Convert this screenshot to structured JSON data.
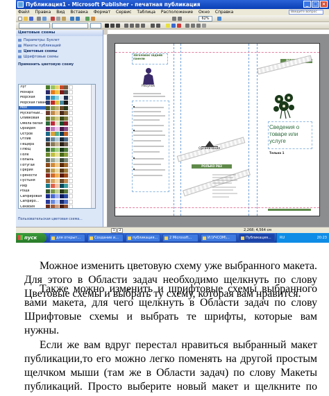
{
  "window": {
    "title": "Публикация1 - Microsoft Publisher - печатная публикация",
    "controls": [
      "_",
      "□",
      "×"
    ]
  },
  "menu": {
    "items": [
      "Файл",
      "Правка",
      "Вид",
      "Вставка",
      "Формат",
      "Сервис",
      "Таблица",
      "Расположение",
      "Окно",
      "Справка"
    ],
    "help_placeholder": "Введите вопрос"
  },
  "toolbar": {
    "zoom": "62%"
  },
  "task_pane": {
    "title": "Цветовые схемы",
    "nav_links": [
      "Параметры: Буклет",
      "Макеты публикаций",
      "Цветовые схемы",
      "Шрифтовые схемы"
    ],
    "active_link_index": 2,
    "apply_label": "Применить цветовую схему",
    "schemes": [
      {
        "name": "Луг",
        "colors": [
          "#4a7a2a",
          "#9cc45a",
          "#e8d46a",
          "#c84a2a",
          "#7a5a3a",
          "#ffffff"
        ]
      },
      {
        "name": "Монарх",
        "colors": [
          "#2a2a6a",
          "#e87a1a",
          "#f0c040",
          "#7a1a1a",
          "#4a4a4a",
          "#ffffff"
        ]
      },
      {
        "name": "Морская",
        "colors": [
          "#1a4a8a",
          "#3aa0c0",
          "#8ad0e0",
          "#e0e8f0",
          "#1a2a4a",
          "#ffffff"
        ]
      },
      {
        "name": "Морская гавань",
        "colors": [
          "#2a3a6a",
          "#c02a2a",
          "#e0c040",
          "#4a8aa0",
          "#1a1a1a",
          "#ffffff"
        ]
      },
      {
        "name": "Мох",
        "colors": [
          "#4a5a2a",
          "#8a9a4a",
          "#c0b070",
          "#6a4a2a",
          "#2a3a1a",
          "#ffffff"
        ]
      },
      {
        "name": "Мускатный...",
        "colors": [
          "#6a3a2a",
          "#c08a4a",
          "#e8c890",
          "#4a2a1a",
          "#8a6a3a",
          "#ffffff"
        ]
      },
      {
        "name": "Оливковая",
        "colors": [
          "#5a6a2a",
          "#9aa04a",
          "#d0c880",
          "#3a4a1a",
          "#7a7a3a",
          "#ffffff"
        ]
      },
      {
        "name": "Омела белая",
        "colors": [
          "#2a6a3a",
          "#c02a3a",
          "#e0e0c0",
          "#1a4a2a",
          "#8a1a2a",
          "#ffffff"
        ]
      },
      {
        "name": "Орхидея",
        "colors": [
          "#6a2a6a",
          "#c07ac0",
          "#e8c0e8",
          "#4a1a4a",
          "#8a4a8a",
          "#ffffff"
        ]
      },
      {
        "name": "Остров",
        "colors": [
          "#1a6a8a",
          "#e0a030",
          "#50b090",
          "#0a3a5a",
          "#c06020",
          "#ffffff"
        ]
      },
      {
        "name": "Отлив",
        "colors": [
          "#2a4a6a",
          "#6a8aa0",
          "#b0c8d8",
          "#1a2a3a",
          "#4a6a8a",
          "#ffffff"
        ]
      },
      {
        "name": "Пещера",
        "colors": [
          "#4a3a2a",
          "#8a7a5a",
          "#c0b090",
          "#2a2018",
          "#6a5a4a",
          "#ffffff"
        ]
      },
      {
        "name": "Плющ",
        "colors": [
          "#2a5a2a",
          "#5a9a4a",
          "#a0d080",
          "#1a3a1a",
          "#4a7a3a",
          "#ffffff"
        ]
      },
      {
        "name": "Поле",
        "colors": [
          "#6a8a2a",
          "#c0c040",
          "#e8e090",
          "#4a6a1a",
          "#8aa03a",
          "#ffffff"
        ]
      },
      {
        "name": "Полынь",
        "colors": [
          "#5a6a5a",
          "#9aa89a",
          "#d0d8c8",
          "#3a4a3a",
          "#7a8a7a",
          "#ffffff"
        ]
      },
      {
        "name": "Потугай",
        "colors": [
          "#8a4a1a",
          "#d08a3a",
          "#f0c880",
          "#5a2a0a",
          "#a06a2a",
          "#ffffff"
        ]
      },
      {
        "name": "Прерия",
        "colors": [
          "#7a5a2a",
          "#c0a050",
          "#e8d8a0",
          "#5a3a1a",
          "#a08040",
          "#ffffff"
        ]
      },
      {
        "name": "Пряности",
        "colors": [
          "#8a2a1a",
          "#d06a2a",
          "#f0b050",
          "#5a1a0a",
          "#a04a1a",
          "#ffffff"
        ]
      },
      {
        "name": "Пустыня",
        "colors": [
          "#a06a3a",
          "#d8a860",
          "#f0d8a8",
          "#6a4a2a",
          "#c08a50",
          "#ffffff"
        ]
      },
      {
        "name": "Риф",
        "colors": [
          "#1a7a8a",
          "#e0604a",
          "#f0c0a0",
          "#0a4a5a",
          "#40a0a0",
          "#ffffff"
        ]
      },
      {
        "name": "Роща",
        "colors": [
          "#3a5a2a",
          "#7a9a4a",
          "#c0d090",
          "#2a3a1a",
          "#5a7a3a",
          "#ffffff"
        ]
      },
      {
        "name": "Сапфировая",
        "colors": [
          "#1a2a8a",
          "#4a6ad0",
          "#a0b0f0",
          "#0a1a5a",
          "#2a4aa0",
          "#ffffff"
        ]
      },
      {
        "name": "Сапфиро...",
        "colors": [
          "#2a3a9a",
          "#6a8ae0",
          "#c0d0f8",
          "#1a2a6a",
          "#4a6ac0",
          "#ffffff"
        ]
      },
      {
        "name": "Секвойя",
        "colors": [
          "#6a2a1a",
          "#a05a3a",
          "#d0a080",
          "#4a1a0a",
          "#8a4a2a",
          "#ffffff"
        ]
      },
      {
        "name": "Сине-зеленая",
        "colors": [
          "#1a5a6a",
          "#3a9aa0",
          "#90d0d0",
          "#0a3a4a",
          "#2a7a8a",
          "#ffffff"
        ]
      }
    ],
    "selected_scheme_index": 4,
    "footer_link": "Пользовательская цветовая схема..."
  },
  "document": {
    "panels": {
      "left_title": "Заголовок задней панели",
      "picture_caption": "Рисунок",
      "org_name": "Организация",
      "middle_bar": "РОЛЬКО РАЗ",
      "right_bar": "РОЛЬКО РАЗ",
      "heading": "Сведения о товаре или услуге",
      "subheading": "Тельна 1"
    }
  },
  "status": {
    "pages": [
      "1",
      "2"
    ],
    "coords": "2,268; 4,564 см"
  },
  "taskbar": {
    "start": "пуск",
    "buttons": [
      "для открыт...",
      "Создание и...",
      "публикация...",
      "2 Microsoft...",
      "И:\\УЧСОМ\\...",
      "Публикация..."
    ],
    "active_button_index": 5,
    "language": "RU",
    "clock": "20:23"
  },
  "body": {
    "p1": "Можное изменить цветовую схему уже выбранного макета. Для этого в Области задач необходимо щелкнуть по слову Цветовые схемы и выбрать ту схему, которая вам нравится.",
    "p2": "Также можно изменить и шрифтовые схемы выбранного вами макета, для чего щелкнуть в Области задач по слову Шрифтовые схемы и выбрать те шрифты, которые вам нужны.",
    "p3": "Если же вам вдруг перестал нравиться выбранный макет публикации,то его можно легко поменять на другой простым щелчком мыши (там же в Области задач) по слову Макеты публикаций. Просто выберите новый макет и щелкните по нему мышью."
  }
}
